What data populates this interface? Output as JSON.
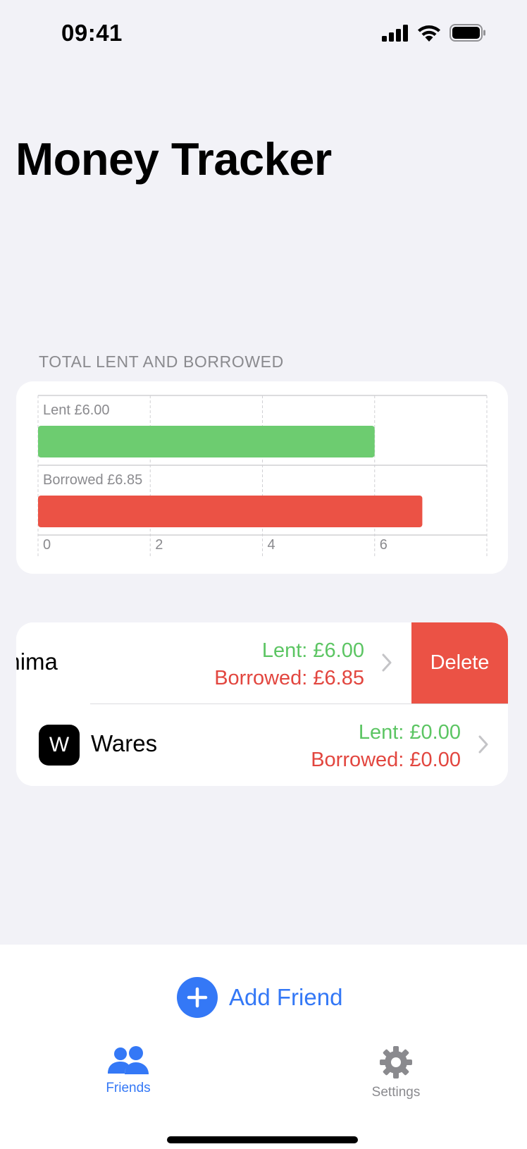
{
  "status_bar": {
    "time": "09:41"
  },
  "title": "Money Tracker",
  "chart_section": {
    "header": "TOTAL LENT AND BORROWED"
  },
  "chart_data": {
    "type": "bar",
    "orientation": "horizontal",
    "categories": [
      "Lent £6.00",
      "Borrowed £6.85"
    ],
    "values": [
      6.0,
      6.85
    ],
    "colors": [
      "#6dcc70",
      "#eb5245"
    ],
    "x_ticks": [
      "0",
      "2",
      "4",
      "6"
    ],
    "xlim": [
      0,
      8
    ],
    "grid": true
  },
  "friends": [
    {
      "name": "uhima",
      "lent": "Lent: £6.00",
      "borrowed": "Borrowed: £6.85",
      "delete_label": "Delete"
    },
    {
      "initial": "W",
      "name": "Wares",
      "lent": "Lent: £0.00",
      "borrowed": "Borrowed: £0.00"
    }
  ],
  "add_friend": {
    "label": "Add Friend"
  },
  "tabs": [
    {
      "label": "Friends",
      "icon": "people-icon",
      "active": true
    },
    {
      "label": "Settings",
      "icon": "gear-icon",
      "active": false
    }
  ],
  "colors": {
    "accent": "#3478f6",
    "lent": "#5cc563",
    "borrowed": "#e2463f",
    "delete": "#eb5245"
  }
}
